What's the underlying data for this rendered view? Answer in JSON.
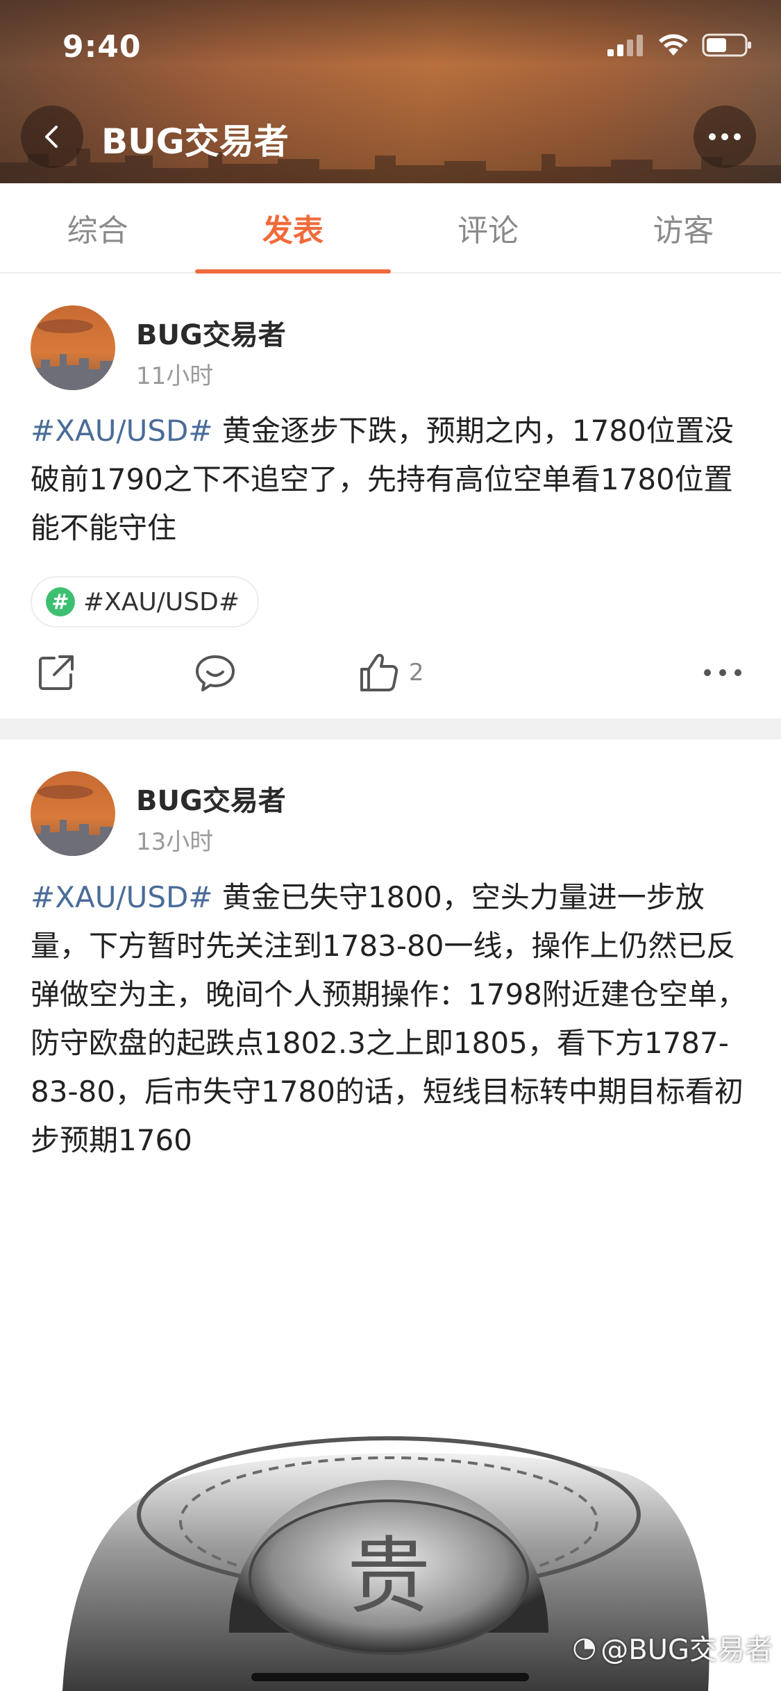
{
  "status_bar": {
    "time": "9:40"
  },
  "header": {
    "title": "BUG交易者",
    "back_icon": "chevron-left-icon",
    "more_icon": "ellipsis-icon"
  },
  "tabs": [
    {
      "label": "综合",
      "active": false
    },
    {
      "label": "发表",
      "active": true
    },
    {
      "label": "评论",
      "active": false
    },
    {
      "label": "访客",
      "active": false
    }
  ],
  "posts": [
    {
      "author": "BUG交易者",
      "time": "11小时",
      "hashtag": "#XAU/USD#",
      "text": " 黄金逐步下跌，预期之内，1780位置没破前1790之下不追空了，先持有高位空单看1780位置能不能守住",
      "topic_chip": "#XAU/USD#",
      "like_count": "2"
    },
    {
      "author": "BUG交易者",
      "time": "13小时",
      "hashtag": "#XAU/USD#",
      "text": " 黄金已失守1800，空头力量进一步放量，下方暂时先关注到1783-80一线，操作上仍然已反弹做空为主，晚间个人预期操作：1798附近建仓空单，防守欧盘的起跌点1802.3之上即1805，看下方1787-83-80，后市失守1780的话，短线目标转中期目标看初步预期1760"
    }
  ],
  "photo": {
    "glyph": "贵",
    "watermark": "@BUG交易者"
  },
  "colors": {
    "accent": "#f06b3a",
    "hashtag": "#4a6c98",
    "topic_icon": "#3cbf71"
  }
}
